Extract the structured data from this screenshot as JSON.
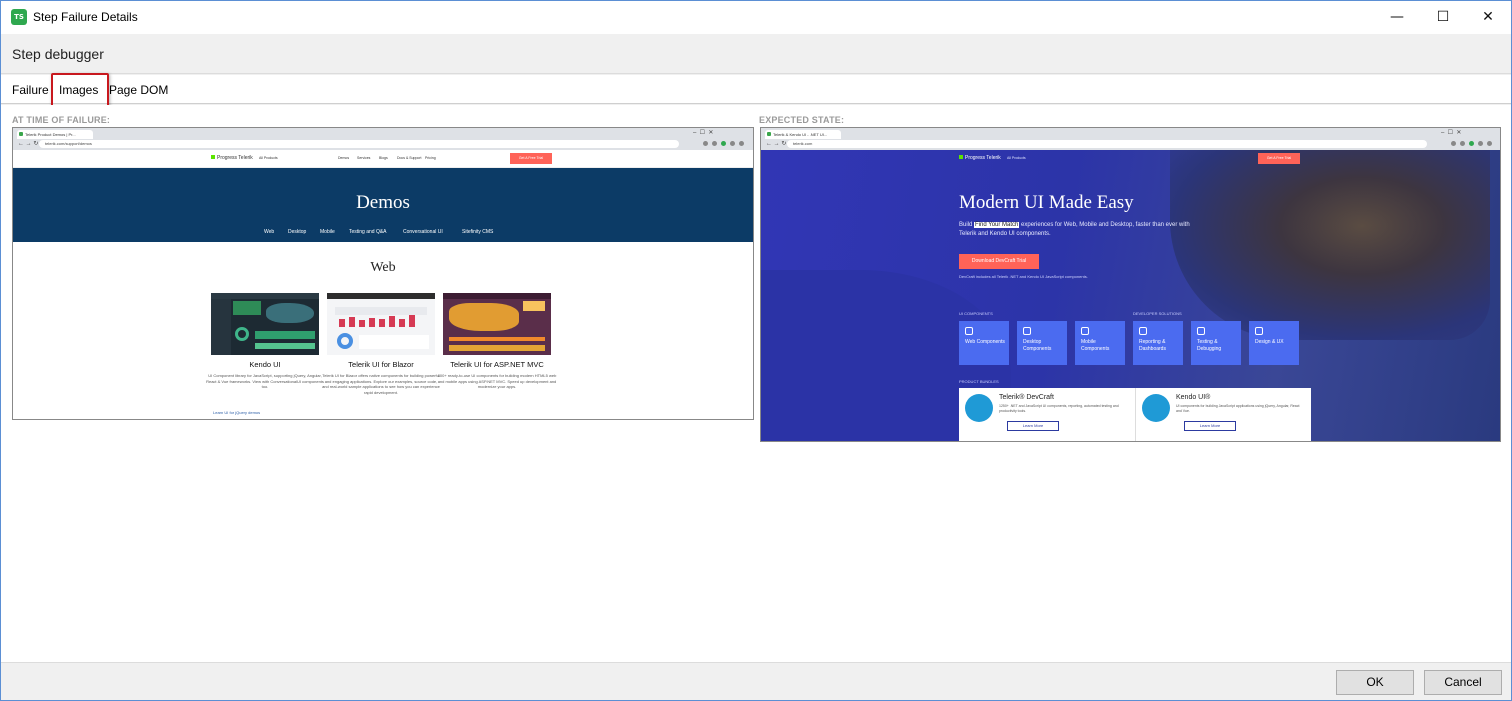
{
  "window": {
    "title": "Step Failure Details",
    "app_icon_text": "TS",
    "minimize": "—",
    "maximize": "☐",
    "close": "✕"
  },
  "header": {
    "title": "Step debugger"
  },
  "tabs": [
    {
      "label": "Failure"
    },
    {
      "label": "Images",
      "selected": true
    },
    {
      "label": "Page DOM"
    }
  ],
  "failure": {
    "label": "AT TIME OF FAILURE:",
    "browser": {
      "tab": "Telerik Product Demos | Pr...",
      "url": "telerik.com/support/demos"
    },
    "site": {
      "logo": "Progress Telerik",
      "all_products": "All Products",
      "nav": [
        "Demos",
        "Services",
        "Blogs",
        "Docs & Support",
        "Pricing"
      ],
      "trial_btn": "Get A Free Trial",
      "banner_title": "Demos",
      "banner_links": [
        "Web",
        "Desktop",
        "Mobile",
        "Testing and Q&A",
        "Conversational UI",
        "Sitefinity CMS"
      ],
      "section_title": "Web",
      "cards": [
        {
          "title": "Kendo UI",
          "desc": "UI Component library for JavaScript, supporting jQuery, Angular, React & Vue frameworks. View with ConversationalUI components too.",
          "link": "Learn UI for jQuery demos"
        },
        {
          "title": "Telerik UI for Blazor",
          "desc": "Telerik UI for Blazor offers native components for building powerful and engaging applications. Explore our examples, source code, and real-world sample applications to see how you can experience rapid development.",
          "link": ""
        },
        {
          "title": "Telerik UI for ASP.NET MVC",
          "desc": "100+ ready-to-use UI components for building modern HTML5 web and mobile apps using ASP.NET MVC. Speed up development and modernize your apps.",
          "link": ""
        }
      ]
    }
  },
  "expected": {
    "label": "EXPECTED STATE:",
    "browser": {
      "tab": "Telerik & Kendo UI - .NET UI...",
      "url": "telerik.com"
    },
    "site": {
      "logo": "Progress Telerik",
      "all_products": "All Products",
      "trial_btn": "Get A Free Trial",
      "hero_title": "Modern UI Made Easy",
      "hero_sub_before": "Build ",
      "hero_sub_highlight": "Find Your Match",
      "hero_sub_after": " experiences for Web, Mobile and Desktop, faster than ever with Telerik and Kendo UI components.",
      "hero_btn": "Download DevCraft Trial",
      "hero_note": "DevCraft includes all Telerik .NET and Kendo UI JavaScript components.",
      "ui_label": "UI COMPONENTS",
      "dev_label": "DEVELOPER SOLUTIONS",
      "tiles": [
        "Web Components",
        "Desktop Components",
        "Mobile Components",
        "Reporting & Dashboards",
        "Testing & Debugging",
        "Design & UX"
      ],
      "bundles_label": "PRODUCT BUNDLES",
      "bundles": [
        {
          "title": "Telerik® DevCraft",
          "desc": "1250+ .NET and JavaScript UI components, reporting, automated testing and productivity tools.",
          "link": "Learn More"
        },
        {
          "title": "Kendo UI®",
          "desc": "UI components for building JavaScript applications using jQuery, Angular, React and Vue.",
          "link": "Learn More"
        }
      ]
    }
  },
  "footer": {
    "ok": "OK",
    "cancel": "Cancel"
  }
}
